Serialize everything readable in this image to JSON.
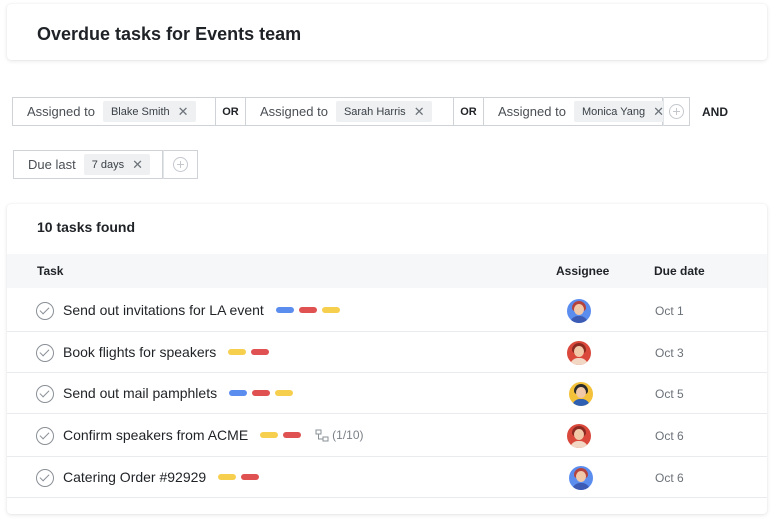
{
  "header": {
    "title": "Overdue tasks for Events team"
  },
  "filters": {
    "assigned_label": "Assigned to",
    "assignees": [
      "Blake Smith",
      "Sarah Harris",
      "Monica Yang"
    ],
    "or_label": "OR",
    "and_label": "AND",
    "due_label": "Due last",
    "due_value": "7 days",
    "remove_glyph": "✕"
  },
  "tasks": {
    "count_text": "10 tasks found",
    "columns": {
      "task": "Task",
      "assignee": "Assignee",
      "due": "Due date"
    },
    "tag_colors": {
      "blue": "#5b8def",
      "red": "#e05252",
      "yellow": "#f7cf4f"
    },
    "rows": [
      {
        "name": "Send out invitations for LA event",
        "tags": [
          "blue",
          "red",
          "yellow"
        ],
        "subtasks": "",
        "due": "Oct 1",
        "avatar": "avatar-woman-blue"
      },
      {
        "name": "Book flights for speakers",
        "tags": [
          "yellow",
          "red"
        ],
        "subtasks": "",
        "due": "Oct 3",
        "avatar": "avatar-woman-red"
      },
      {
        "name": "Send out mail pamphlets",
        "tags": [
          "blue",
          "red",
          "yellow"
        ],
        "subtasks": "",
        "due": "Oct 5",
        "avatar": "avatar-man-yellow"
      },
      {
        "name": "Confirm speakers from ACME",
        "tags": [
          "yellow",
          "red"
        ],
        "subtasks": "(1/10)",
        "due": "Oct 6",
        "avatar": "avatar-woman-red"
      },
      {
        "name": "Catering Order #92929",
        "tags": [
          "yellow",
          "red"
        ],
        "subtasks": "",
        "due": "Oct 6",
        "avatar": "avatar-woman-blue"
      }
    ]
  }
}
